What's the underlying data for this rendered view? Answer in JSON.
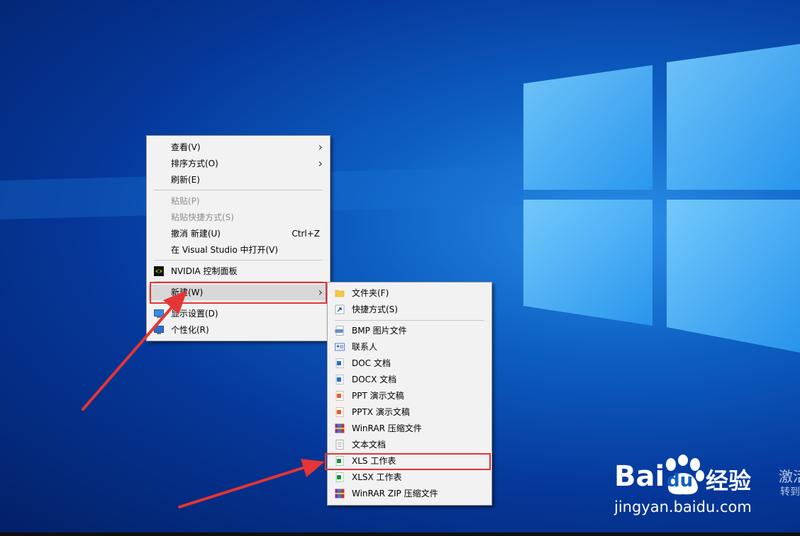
{
  "context_menu": {
    "items": [
      {
        "label": "查看(V)",
        "submenu": true
      },
      {
        "label": "排序方式(O)",
        "submenu": true
      },
      {
        "label": "刷新(E)"
      },
      {
        "label": "粘贴(P)",
        "disabled": true
      },
      {
        "label": "粘贴快捷方式(S)",
        "disabled": true
      },
      {
        "label": "撤消 新建(U)",
        "shortcut": "Ctrl+Z"
      },
      {
        "label": "在 Visual Studio 中打开(V)"
      },
      {
        "label": "NVIDIA 控制面板",
        "icon": "nvidia-icon"
      },
      {
        "label": "新建(W)",
        "submenu": true,
        "highlighted": true
      },
      {
        "label": "显示设置(D)",
        "icon": "display-icon"
      },
      {
        "label": "个性化(R)",
        "icon": "personalize-icon"
      }
    ]
  },
  "new_submenu": {
    "items": [
      {
        "label": "文件夹(F)",
        "icon": "folder-icon"
      },
      {
        "label": "快捷方式(S)",
        "icon": "shortcut-icon"
      },
      {
        "label": "BMP 图片文件",
        "icon": "bmp-icon"
      },
      {
        "label": "联系人",
        "icon": "contact-icon"
      },
      {
        "label": "DOC 文档",
        "icon": "doc-icon"
      },
      {
        "label": "DOCX 文档",
        "icon": "docx-icon"
      },
      {
        "label": "PPT 演示文稿",
        "icon": "ppt-icon"
      },
      {
        "label": "PPTX 演示文稿",
        "icon": "pptx-icon"
      },
      {
        "label": "WinRAR 压缩文件",
        "icon": "winrar-icon"
      },
      {
        "label": "文本文档",
        "icon": "text-document-icon"
      },
      {
        "label": "XLS 工作表",
        "icon": "xls-icon",
        "boxed": true
      },
      {
        "label": "XLSX 工作表",
        "icon": "xlsx-icon"
      },
      {
        "label": "WinRAR ZIP 压缩文件",
        "icon": "winrar-zip-icon"
      }
    ]
  },
  "watermark": {
    "brand_bai": "Bai",
    "brand_du": "du",
    "brand_cn": "经验",
    "url": "jingyan.baidu.com",
    "activation_1": "激活",
    "activation_2": "转到"
  },
  "colors": {
    "highlight_box": "#e53535",
    "menu_bg": "#f2f2f2",
    "desktop_blue": "#0d5fc2"
  }
}
